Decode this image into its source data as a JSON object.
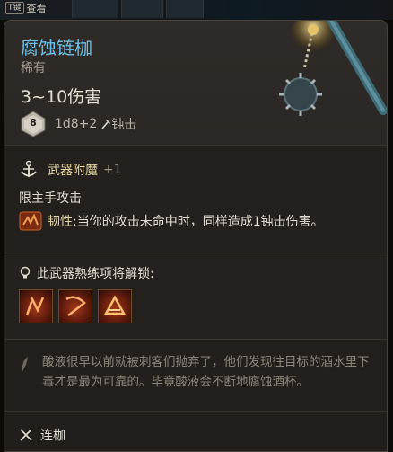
{
  "top_bar": {
    "key": "T键",
    "label": "查看"
  },
  "item": {
    "name": "腐蚀链枷",
    "rarity": "稀有",
    "damage": "3~10伤害",
    "dice_value": "8",
    "dice_formula": "1d8+2",
    "damage_type": "钝击",
    "name_color": "#6ec0e6"
  },
  "enchant": {
    "label": "武器附魔",
    "value": "+1",
    "restriction": "限主手攻击",
    "trait_name": "韧性:",
    "trait_desc": " 当你的攻击未命中时，同样造成1钝击伤害。"
  },
  "mastery": {
    "title": "此武器熟练项将解锁:",
    "skills": [
      {
        "icon": "brace-strike-icon"
      },
      {
        "icon": "topple-strike-icon"
      },
      {
        "icon": "crushing-strike-icon"
      }
    ]
  },
  "lore": "酸液很早以前就被刺客们抛弃了，他们发现往目标的酒水里下毒才是最为可靠的。毕竟酸液会不断地腐蚀酒杯。",
  "footer": {
    "category": "连枷",
    "weight": "",
    "value": ""
  }
}
